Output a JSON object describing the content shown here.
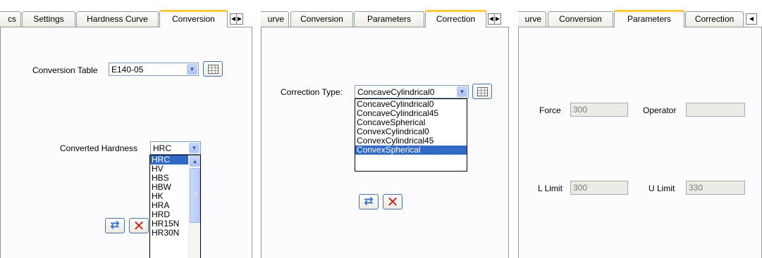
{
  "panel1": {
    "tabs": [
      "cs",
      "Settings",
      "Hardness Curve",
      "Conversion"
    ],
    "scroll_left": "◀",
    "scroll_right": "▶",
    "conversion_table_label": "Conversion Table",
    "conversion_table_value": "E140-05",
    "converted_hardness_label": "Converted Hardness",
    "converted_hardness_value": "HRC",
    "dropdown_options": [
      "HRC",
      "HV",
      "HBS",
      "HBW",
      "HK",
      "HRA",
      "HRD",
      "HR15N",
      "HR30N"
    ],
    "dropdown_selected": "HRC"
  },
  "panel2": {
    "tabs": [
      "urve",
      "Conversion",
      "Parameters",
      "Correction"
    ],
    "scroll_left": "◀",
    "scroll_right": "▶",
    "correction_type_label": "Correction Type:",
    "correction_type_value": "ConcaveCylindrical0",
    "dropdown_options": [
      "ConcaveCylindrical0",
      "ConcaveCylindrical45",
      "ConcaveSpherical",
      "ConvexCylindrical0",
      "ConvexCylindrical45",
      "ConvexSpherical"
    ],
    "dropdown_selected": "ConvexSpherical"
  },
  "panel3": {
    "tabs": [
      "urve",
      "Conversion",
      "Parameters",
      "Correction"
    ],
    "scroll_left": "◀",
    "force_label": "Force",
    "force_value": "300",
    "operator_label": "Operator",
    "operator_value": "",
    "l_limit_label": "L Limit",
    "l_limit_value": "300",
    "u_limit_label": "U Limit",
    "u_limit_value": "330"
  },
  "icons": {
    "grid": "table-grid-icon",
    "refresh": "refresh-icon",
    "close": "close-icon",
    "dropdown": "chevron-down-icon"
  },
  "colors": {
    "active_tab_accent": "#ffc83c",
    "selection": "#316ac5",
    "combo_border": "#7f9db9"
  }
}
